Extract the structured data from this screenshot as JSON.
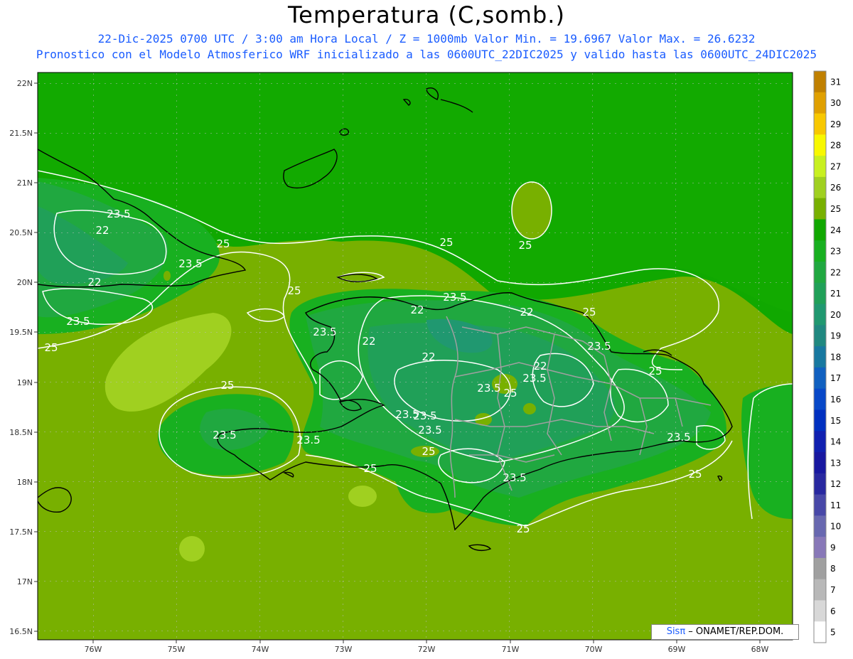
{
  "title": "Temperatura (C,somb.)",
  "subtitle_line1": "22-Dic-2025  0700 UTC / 3:00 am Hora Local / Z = 1000mb   Valor Min. = 19.6967  Valor Max. = 26.6232",
  "subtitle_line2": "Pronostico con el Modelo Atmosferico WRF inicializado a las 0600UTC_22DIC2025 y valido hasta las  0600UTC_24DIC2025",
  "credit_brand": "Sisπ",
  "credit_text": " – ONAMET/REP.DOM.",
  "lat_labels": [
    "22N",
    "21.5N",
    "21N",
    "20.5N",
    "20N",
    "19.5N",
    "19N",
    "18.5N",
    "18N",
    "17.5N",
    "17N",
    "16.5N"
  ],
  "lon_labels": [
    "76W",
    "75W",
    "74W",
    "73W",
    "72W",
    "71W",
    "70W",
    "69W",
    "68W"
  ],
  "colorbar": {
    "labels": [
      "31",
      "30",
      "29",
      "28",
      "27",
      "26",
      "25",
      "24",
      "23",
      "22",
      "21",
      "20",
      "19",
      "18",
      "17",
      "16",
      "15",
      "14",
      "13",
      "12",
      "11",
      "10",
      "9",
      "8",
      "7",
      "6",
      "5"
    ],
    "colors": [
      "#c08000",
      "#e0a000",
      "#f8c800",
      "#f8f800",
      "#c8f020",
      "#a0d020",
      "#78b000",
      "#10a800",
      "#18b020",
      "#20a840",
      "#20a058",
      "#209870",
      "#208880",
      "#1878a0",
      "#1060c0",
      "#0848c8",
      "#0030c0",
      "#1020b0",
      "#1818a0",
      "#2828a0",
      "#4848a8",
      "#6868b0",
      "#8878b8",
      "#a0a0a0",
      "#b8b8b8",
      "#d8d8d8",
      "#ffffff"
    ]
  },
  "contour_labels": [
    "23.5",
    "22",
    "25",
    "23.5",
    "22",
    "23.5",
    "25",
    "25",
    "25",
    "25",
    "23.5",
    "22",
    "22",
    "25",
    "23.5",
    "22",
    "23.5",
    "22",
    "25",
    "23.5",
    "22",
    "25",
    "23.5",
    "23.5",
    "23.5",
    "23.5",
    "25",
    "23.5",
    "23.5",
    "25",
    "23.5",
    "25",
    "25",
    "23.5",
    "25"
  ]
}
